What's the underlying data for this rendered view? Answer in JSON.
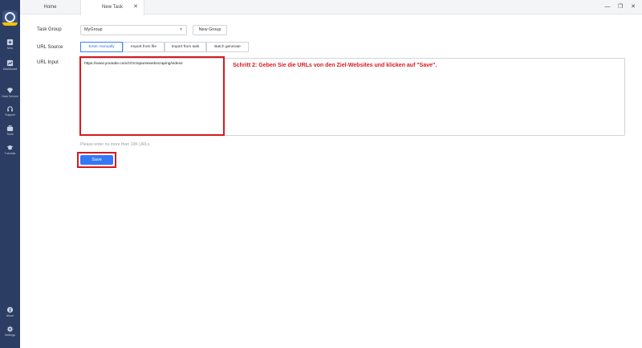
{
  "sidebar": {
    "items": [
      {
        "label": "New",
        "icon": "plus-square-icon"
      },
      {
        "label": "Dashboard",
        "icon": "dashboard-icon"
      },
      {
        "label": "Data Service",
        "icon": "diamond-icon"
      },
      {
        "label": "Support",
        "icon": "headset-icon"
      },
      {
        "label": "Tools",
        "icon": "toolbox-icon"
      },
      {
        "label": "Tutorials",
        "icon": "graduation-cap-icon"
      },
      {
        "label": "About",
        "icon": "info-icon"
      },
      {
        "label": "Settings",
        "icon": "gear-icon"
      }
    ]
  },
  "tabs": {
    "home": "Home",
    "new_task": "New Task",
    "close": "✕"
  },
  "window": {
    "minimize": "—",
    "restore": "❐",
    "close": "✕"
  },
  "form": {
    "task_group_label": "Task Group",
    "task_group_value": "MyGroup",
    "new_group_button": "New Group",
    "url_source_label": "URL Source",
    "url_source_options": [
      "Enter manually",
      "Import from file",
      "Import from task",
      "Batch generate"
    ],
    "url_source_selected": "Enter manually",
    "url_input_label": "URL Input",
    "url_input_value": "https://www.youtube.com/c/Octoparsewebscraping/videos",
    "helper_text": "Please enter no more than 10K URLs.",
    "save_button": "Save"
  },
  "annotation": {
    "text": "Schritt 2: Geben Sie die URLs von den Ziel-Websites und klicken auf \"Save\".",
    "color": "#d71920"
  },
  "colors": {
    "sidebar": "#2c3d63",
    "accent": "#3478f6",
    "highlight": "#d71920"
  }
}
